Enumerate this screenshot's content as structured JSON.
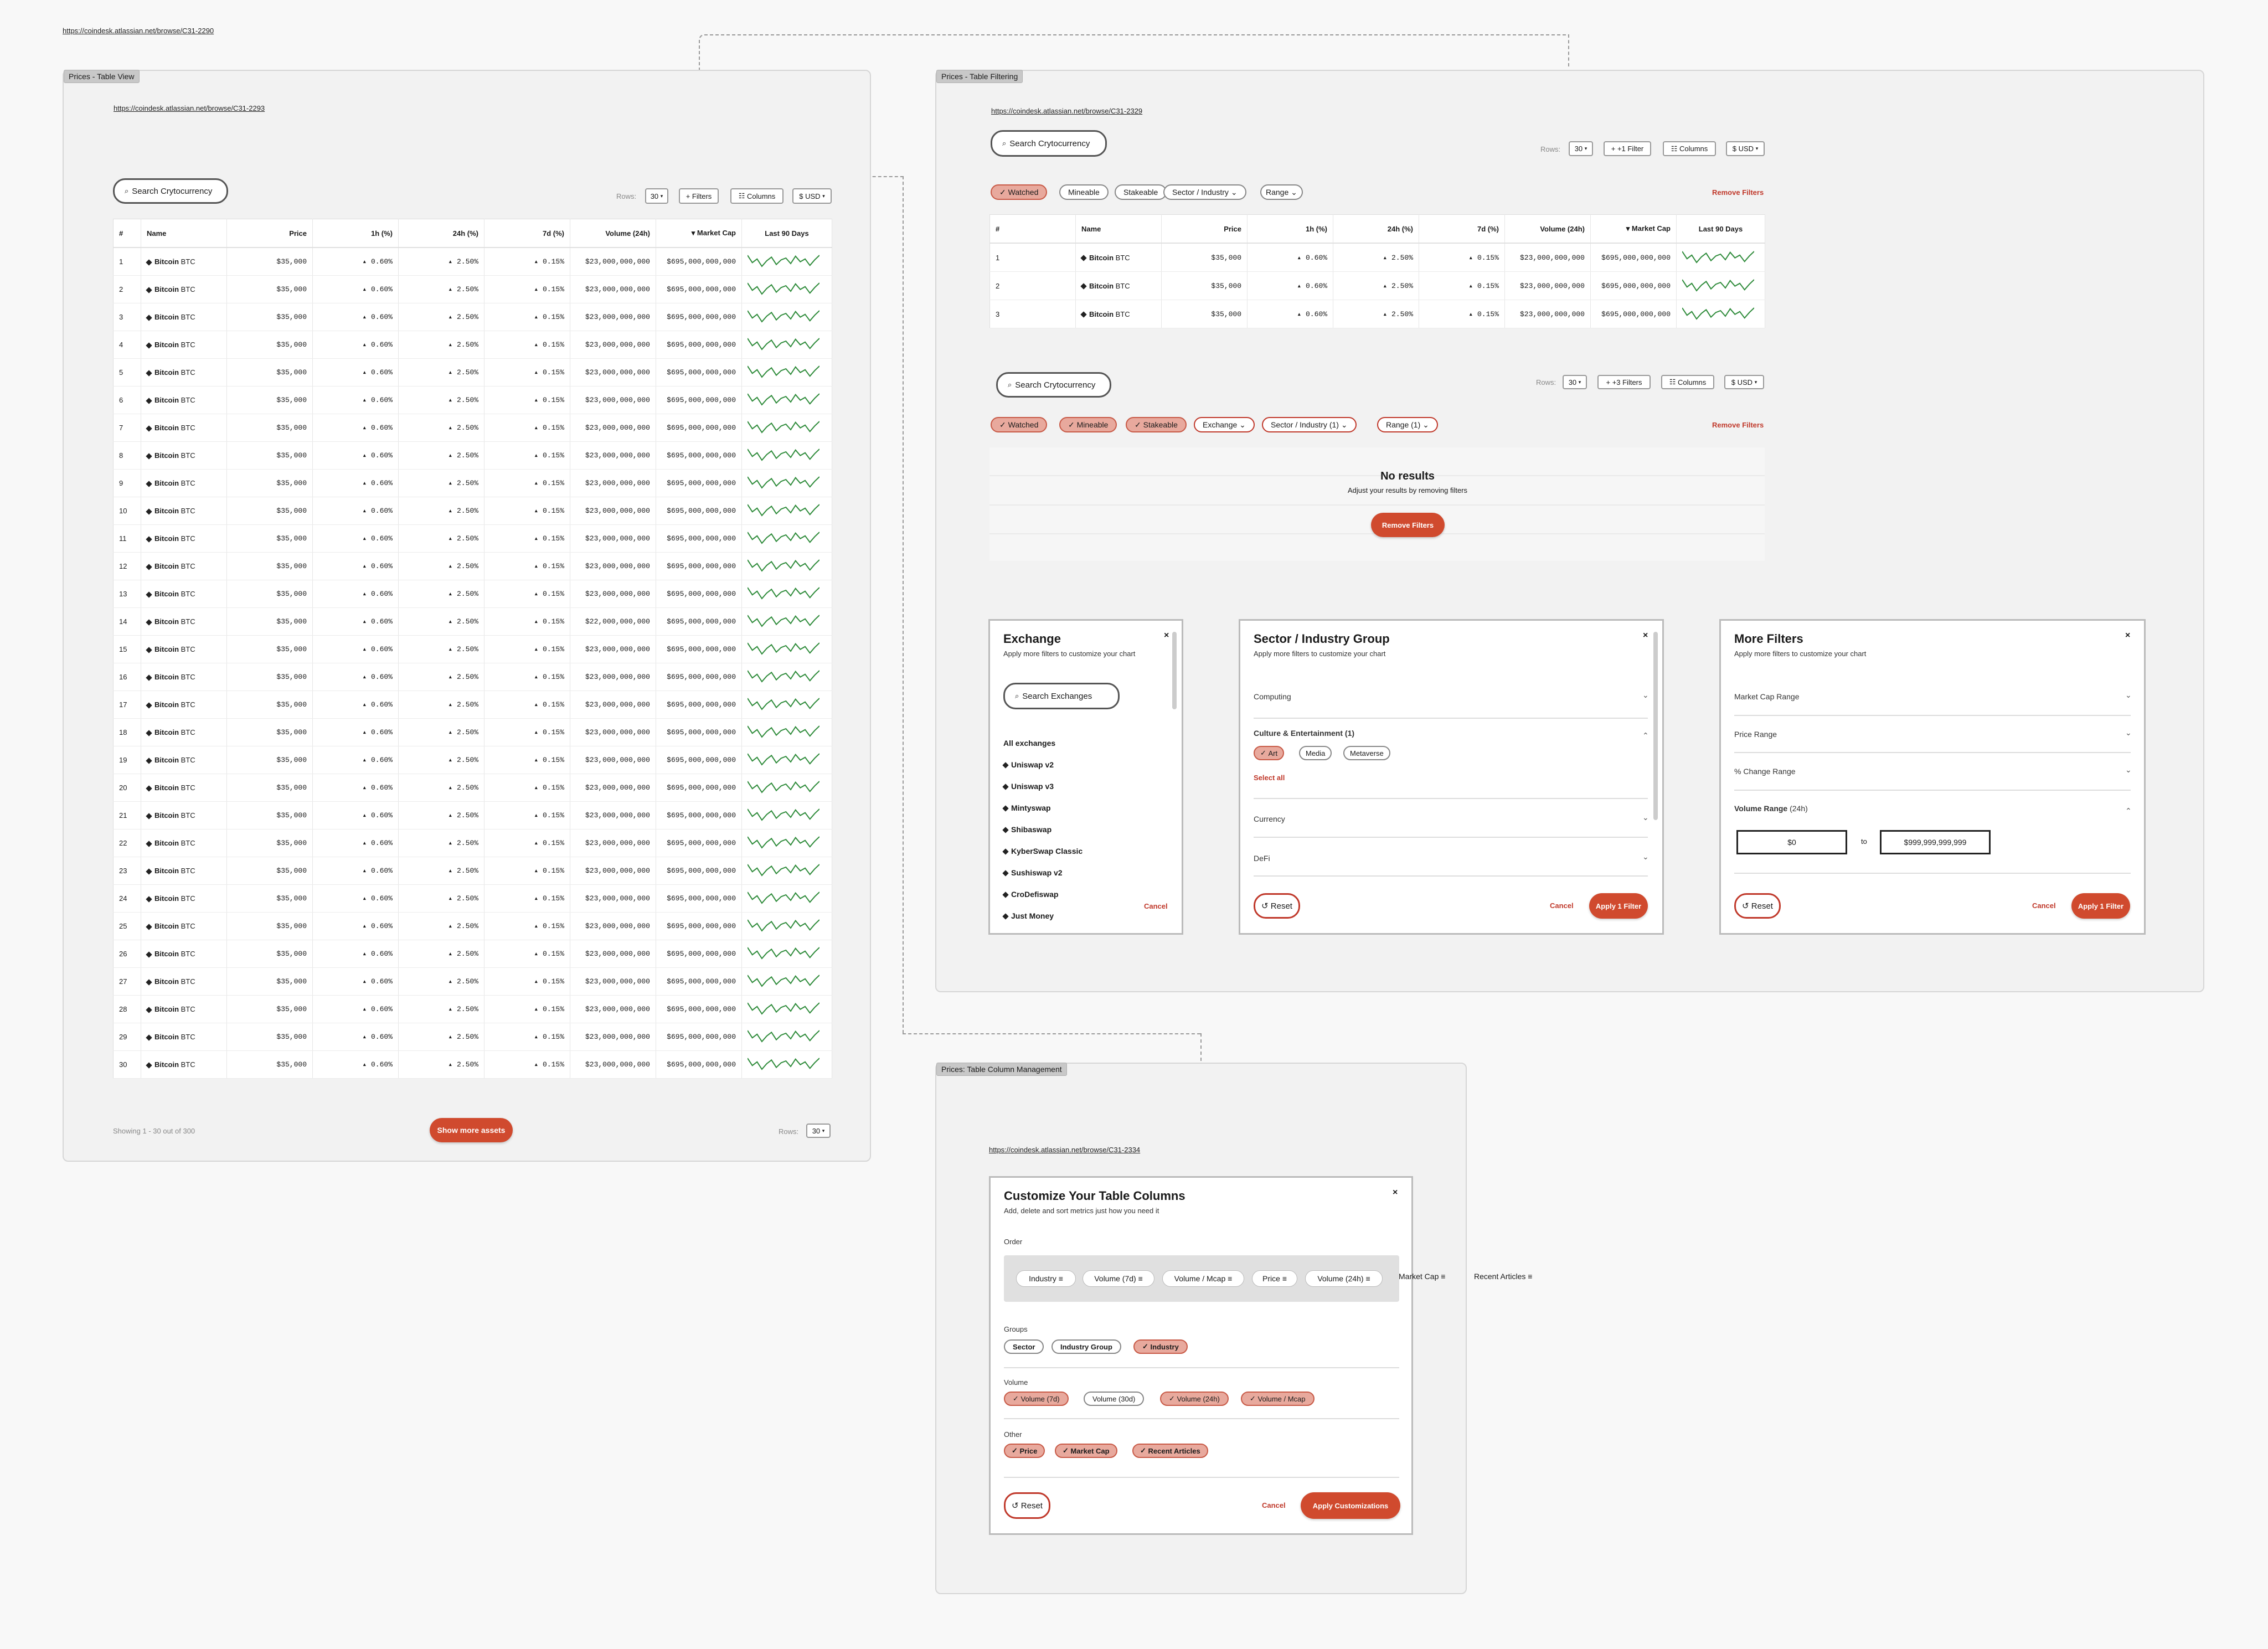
{
  "top_link": "https://coindesk.atlassian.net/browse/C31-2290",
  "table_view": {
    "tag": "Prices - Table View",
    "link": "https://coindesk.atlassian.net/browse/C31-2293",
    "search_placeholder": "Search Crytocurrency",
    "rows_label": "Rows:",
    "rows_value": "30",
    "filters_label": "+ Filters",
    "columns_label": "Columns",
    "currency_label": "$ USD",
    "columns": [
      "#",
      "Name",
      "Price",
      "1h (%)",
      "24h (%)",
      "7d (%)",
      "Volume (24h)",
      "Market Cap",
      "Last 90 Days"
    ],
    "row_template": {
      "name": "Bitcoin",
      "symbol": "BTC",
      "price": "$35,000",
      "h1": "0.60%",
      "h24": "2.50%",
      "d7": "0.15%",
      "volume": "$23,000,000,000",
      "mcap": "$695,000,000,000"
    },
    "row_count": 30,
    "row14_volume": "$22,000,000,000",
    "footer_text": "Showing 1 - 30 out of 300",
    "show_more": "Show more assets"
  },
  "table_filtering": {
    "tag": "Prices - Table Filtering",
    "link": "https://coindesk.atlassian.net/browse/C31-2329",
    "search_placeholder": "Search Crytocurrency",
    "rows_label": "Rows:",
    "rows_value": "30",
    "filter_label": "+1 Filter",
    "filter_label2": "+3 Filters",
    "columns_label": "Columns",
    "currency_label": "$ USD",
    "chips_top": [
      "Watched",
      "Mineable",
      "Stakeable",
      "Sector / Industry",
      "Range"
    ],
    "chips_bottom": [
      "Watched",
      "Mineable",
      "Stakeable",
      "Exchange",
      "Sector / Industry (1)",
      "Range (1)"
    ],
    "remove_filters": "Remove Filters",
    "no_results_title": "No results",
    "no_results_sub": "Adjust your results by removing filters",
    "no_results_button": "Remove Filters"
  },
  "exchange_panel": {
    "title": "Exchange",
    "subtitle": "Apply more filters to customize your chart",
    "search_placeholder": "Search Exchanges",
    "items": [
      "All exchanges",
      "Uniswap v2",
      "Uniswap v3",
      "Mintyswap",
      "Shibaswap",
      "KyberSwap Classic",
      "Sushiswap v2",
      "CroDefiswap",
      "Just Money"
    ],
    "cancel": "Cancel"
  },
  "sector_panel": {
    "title": "Sector / Industry Group",
    "subtitle": "Apply more filters to customize your chart",
    "groups": [
      "Computing",
      "Culture & Entertainment (1)",
      "Currency",
      "DeFi"
    ],
    "chips": [
      "Art",
      "Media",
      "Metaverse"
    ],
    "select_all": "Select all",
    "reset": "Reset",
    "cancel": "Cancel",
    "apply": "Apply 1 Filter"
  },
  "more_filters_panel": {
    "title": "More Filters",
    "subtitle": "Apply more filters to customize your chart",
    "ranges": [
      "Market Cap Range",
      "Price Range",
      "% Change Range"
    ],
    "volume_label": "Volume Range",
    "volume_unit": "(24h)",
    "min_value": "$0",
    "to": "to",
    "max_value": "$999,999,999,999",
    "reset": "Reset",
    "cancel": "Cancel",
    "apply": "Apply 1 Filter"
  },
  "column_mgmt": {
    "tag": "Prices: Table Column Management",
    "link": "https://coindesk.atlassian.net/browse/C31-2334",
    "title": "Customize Your Table Columns",
    "subtitle": "Add, delete and sort metrics just how you need it",
    "order_label": "Order",
    "order_items": [
      "Industry",
      "Volume (7d)",
      "Volume / Mcap",
      "Price",
      "Volume (24h)",
      "Market Cap",
      "Recent Articles"
    ],
    "groups_label": "Groups",
    "groups": [
      "Sector",
      "Industry Group",
      "Industry"
    ],
    "volume_label": "Volume",
    "volume_items": [
      "Volume (7d)",
      "Volume (30d)",
      "Volume (24h)",
      "Volume / Mcap"
    ],
    "other_label": "Other",
    "other_items": [
      "Price",
      "Market Cap",
      "Recent Articles"
    ],
    "reset": "Reset",
    "cancel": "Cancel",
    "apply": "Apply Customizations"
  }
}
